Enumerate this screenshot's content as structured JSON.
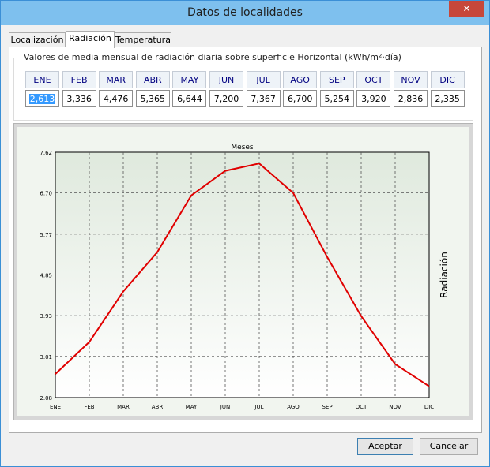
{
  "window": {
    "title": "Datos de localidades",
    "close_glyph": "✕"
  },
  "tabs": [
    {
      "label": "Localización",
      "active": false
    },
    {
      "label": "Radiación",
      "active": true
    },
    {
      "label": "Temperatura",
      "active": false
    }
  ],
  "group": {
    "title": "Valores de media mensual de radiación diaria sobre superficie Horizontal (kWh/m²·día)"
  },
  "months": [
    "ENE",
    "FEB",
    "MAR",
    "ABR",
    "MAY",
    "JUN",
    "JUL",
    "AGO",
    "SEP",
    "OCT",
    "NOV",
    "DIC"
  ],
  "values": [
    "2,613",
    "3,336",
    "4,476",
    "5,365",
    "6,644",
    "7,200",
    "7,367",
    "6,700",
    "5,254",
    "3,920",
    "2,836",
    "2,335"
  ],
  "selected_index": 0,
  "chart_data": {
    "type": "line",
    "title": "Meses",
    "xlabel": "",
    "ylabel": "Radiación",
    "categories": [
      "ENE",
      "FEB",
      "MAR",
      "ABR",
      "MAY",
      "JUN",
      "JUL",
      "AGO",
      "SEP",
      "OCT",
      "NOV",
      "DIC"
    ],
    "series": [
      {
        "values": [
          2.613,
          3.336,
          4.476,
          5.365,
          6.644,
          7.2,
          7.367,
          6.7,
          5.254,
          3.92,
          2.836,
          2.335
        ],
        "color": "#e00000"
      }
    ],
    "yticks": [
      "2.08",
      "3.01",
      "3.93",
      "4.85",
      "5.77",
      "6.70",
      "7.62"
    ],
    "ylim": [
      2.08,
      7.62
    ],
    "grid": true,
    "legend": "none",
    "background_top": "#dfe9dd",
    "background_bottom": "#ffffff"
  },
  "buttons": {
    "accept": "Aceptar",
    "cancel": "Cancelar"
  }
}
